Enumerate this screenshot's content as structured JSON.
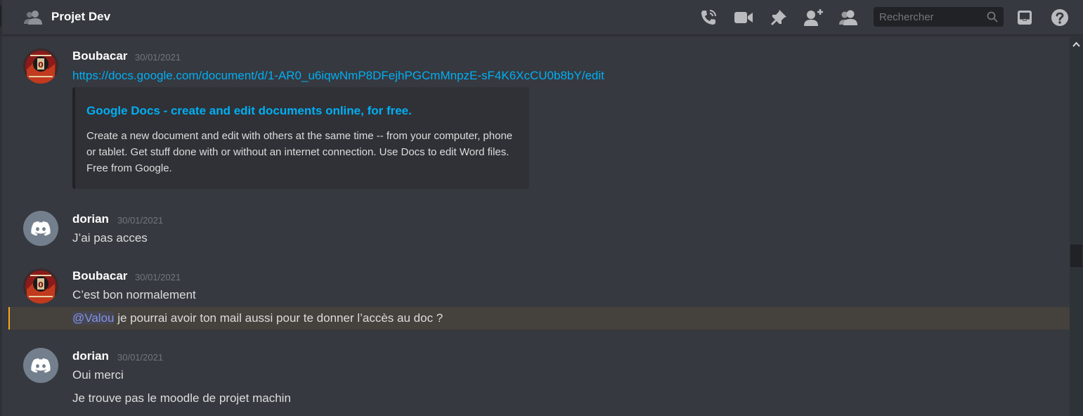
{
  "header": {
    "channel_name": "Projet Dev",
    "channel_icon": "people-icon",
    "search_placeholder": "Rechercher",
    "icons": [
      "phone-call-icon",
      "video-camera-icon",
      "pin-icon",
      "add-friend-icon",
      "members-icon",
      "inbox-icon",
      "help-icon"
    ]
  },
  "messages": [
    {
      "author": "Boubacar",
      "timestamp": "30/01/2021",
      "avatar": "boubacar-avatar",
      "lines": [
        {
          "text": "https://docs.google.com/document/d/1-AR0_u6iqwNmP8DFejhPGCmMnpzE-sF4K6XcCU0b8bY/edit",
          "kind": "link"
        }
      ],
      "embed": {
        "title": "Google Docs - create and edit documents online, for free.",
        "description": "Create a new document and edit with others at the same time -- from your computer, phone or tablet. Get stuff done with or without an internet connection. Use Docs to edit Word files. Free from Google."
      }
    },
    {
      "author": "dorian",
      "timestamp": "30/01/2021",
      "avatar": "discord-default-avatar",
      "lines": [
        {
          "text": "J’ai pas acces"
        }
      ]
    },
    {
      "author": "Boubacar",
      "timestamp": "30/01/2021",
      "avatar": "boubacar-avatar",
      "lines": [
        {
          "text": "C’est bon normalement"
        },
        {
          "mention": "@Valou",
          "text": " je pourrai avoir ton mail aussi pour te donner l’accès au doc ?"
        }
      ]
    },
    {
      "author": "dorian",
      "timestamp": "30/01/2021",
      "avatar": "discord-default-avatar",
      "lines": [
        {
          "text": "Oui merci"
        },
        {
          "text": "Je trouve pas le moodle de projet machin"
        }
      ]
    }
  ],
  "colors": {
    "background": "#36393f",
    "link": "#00aff4",
    "mention": "#7f95e8",
    "mention_bar": "#faa81a",
    "timestamp": "#72767d",
    "discord_blurple": "#5865f2"
  }
}
